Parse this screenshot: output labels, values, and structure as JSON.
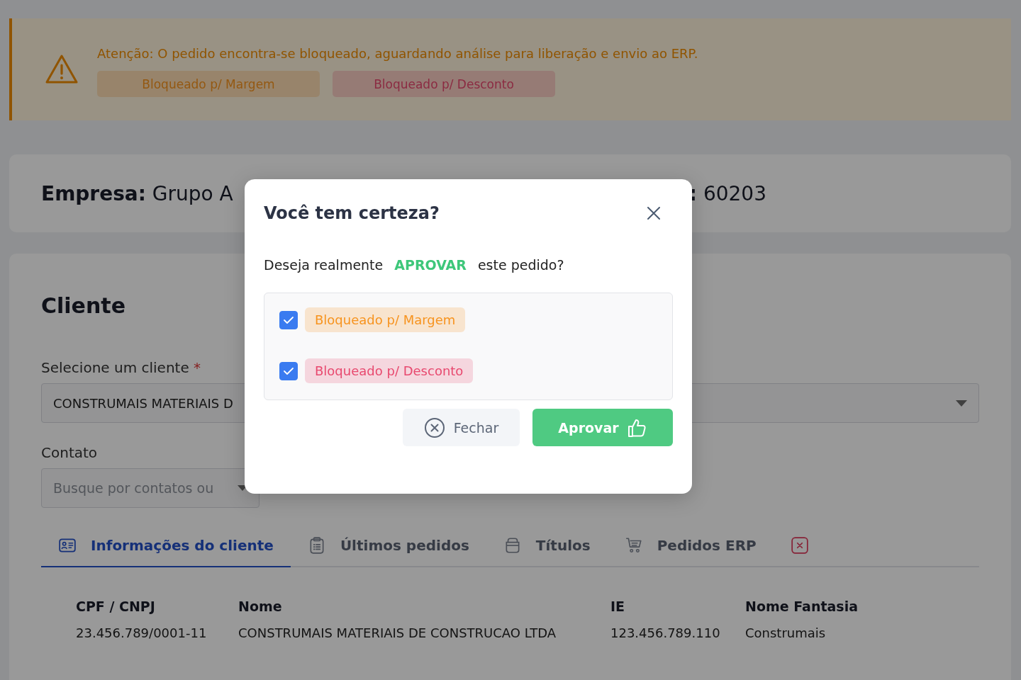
{
  "alert": {
    "message": "Atenção: O pedido encontra-se bloqueado, aguardando análise para liberação e envio ao ERP.",
    "tags": [
      {
        "label": "Bloqueado p/ Margem"
      },
      {
        "label": "Bloqueado p/ Desconto"
      }
    ]
  },
  "header": {
    "company_label": "Empresa:",
    "company_value": "Grupo A",
    "order_label": ":",
    "order_value": "60203"
  },
  "client_section": {
    "title": "Cliente",
    "client_field": {
      "label": "Selecione um cliente",
      "required_mark": "*",
      "value": "CONSTRUMAIS MATERIAIS D"
    },
    "contact_field": {
      "label": "Contato",
      "placeholder": "Busque por contatos ou"
    },
    "tabs": [
      {
        "label": "Informações do cliente",
        "selected": true
      },
      {
        "label": "Últimos pedidos",
        "selected": false
      },
      {
        "label": "Títulos",
        "selected": false
      },
      {
        "label": "Pedidos ERP",
        "selected": false
      },
      {
        "selected": false
      }
    ],
    "details": [
      {
        "label": "CPF / CNPJ",
        "value": "23.456.789/0001-11"
      },
      {
        "label": "Nome",
        "value": "CONSTRUMAIS MATERIAIS DE CONSTRUCAO LTDA"
      },
      {
        "label": "IE",
        "value": "123.456.789.110"
      },
      {
        "label": "Nome Fantasia",
        "value": "Construmais"
      }
    ]
  },
  "dialog": {
    "title": "Você tem certeza?",
    "question_prefix": "Deseja realmente",
    "question_action": "APROVAR",
    "question_suffix": "este pedido?",
    "checks": [
      {
        "label": "Bloqueado p/ Margem",
        "checked": true,
        "color": "#f7931e"
      },
      {
        "label": "Bloqueado p/ Desconto",
        "checked": true,
        "color": "#e8496f"
      }
    ],
    "buttons": [
      {
        "label": "Fechar",
        "kind": "cancel"
      },
      {
        "label": "Aprovar",
        "kind": "approve"
      }
    ]
  }
}
